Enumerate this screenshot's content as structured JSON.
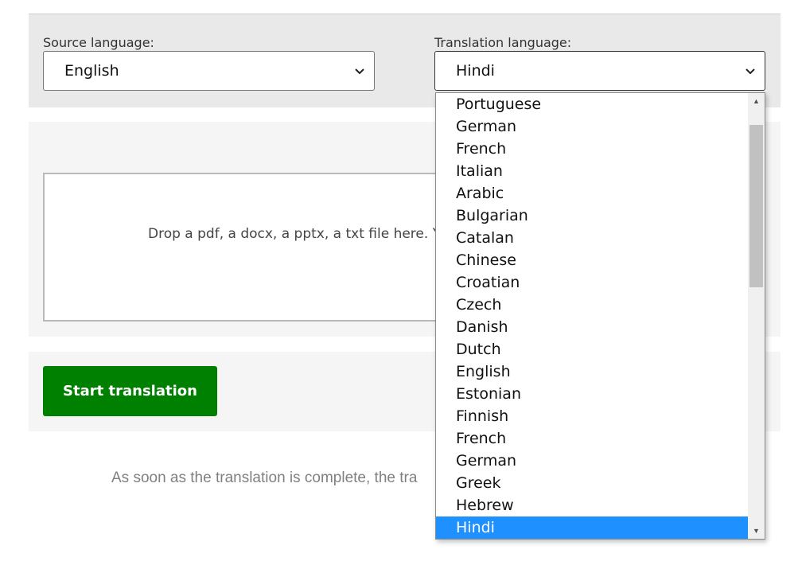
{
  "source": {
    "label": "Source language:",
    "value": "English"
  },
  "target": {
    "label": "Translation language:",
    "value": "Hindi"
  },
  "dropzone": {
    "text": "Drop a pdf, a docx, a pptx, a txt file here. You"
  },
  "actions": {
    "start_label": "Start translation"
  },
  "status": {
    "text": "As soon as the translation is complete, the tra"
  },
  "dropdown": {
    "items": [
      "Portuguese",
      "German",
      "French",
      "Italian",
      "Arabic",
      "Bulgarian",
      "Catalan",
      "Chinese",
      "Croatian",
      "Czech",
      "Danish",
      "Dutch",
      "English",
      "Estonian",
      "Finnish",
      "French",
      "German",
      "Greek",
      "Hebrew",
      "Hindi"
    ],
    "selected": "Hindi"
  },
  "icons": {
    "select_chevron": "chevron-down-icon",
    "scroll_up": "triangle-up-icon",
    "scroll_down": "triangle-down-icon"
  },
  "colors": {
    "start_button": "#008000",
    "selected_option": "#1e90ff"
  }
}
